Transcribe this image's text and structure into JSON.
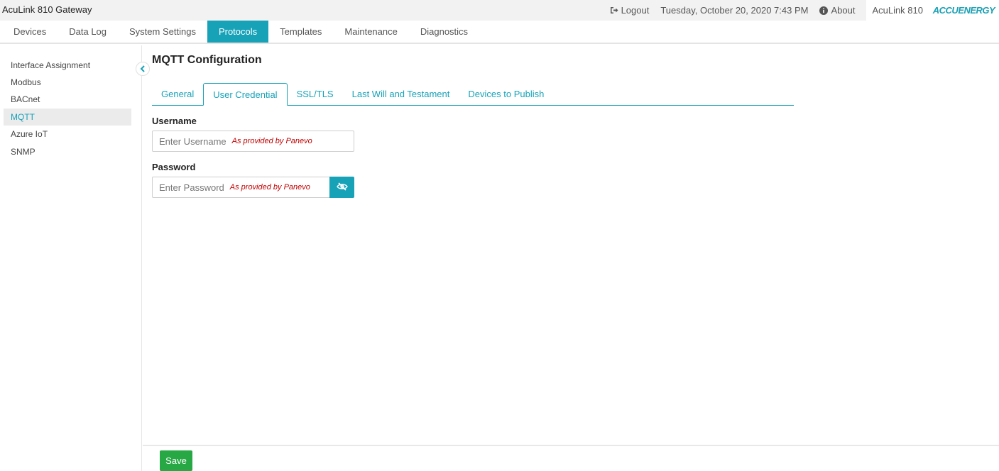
{
  "app": {
    "title": "AcuLink 810 Gateway"
  },
  "header": {
    "logout_label": "Logout",
    "datetime": "Tuesday, October 20, 2020 7:43 PM",
    "about_label": "About",
    "device_name": "AcuLink 810",
    "brand_logo": "ACCUENERGY"
  },
  "nav": {
    "tabs": [
      {
        "label": "Devices"
      },
      {
        "label": "Data Log"
      },
      {
        "label": "System Settings"
      },
      {
        "label": "Protocols",
        "active": true
      },
      {
        "label": "Templates"
      },
      {
        "label": "Maintenance"
      },
      {
        "label": "Diagnostics"
      }
    ]
  },
  "sidebar": {
    "items": [
      {
        "label": "Interface Assignment"
      },
      {
        "label": "Modbus"
      },
      {
        "label": "BACnet"
      },
      {
        "label": "MQTT",
        "active": true
      },
      {
        "label": "Azure IoT"
      },
      {
        "label": "SNMP"
      }
    ],
    "collapse_icon": "chevron-left-icon"
  },
  "main": {
    "title": "MQTT Configuration",
    "tabs": [
      {
        "label": "General"
      },
      {
        "label": "User Credential",
        "active": true
      },
      {
        "label": "SSL/TLS"
      },
      {
        "label": "Last Will and Testament"
      },
      {
        "label": "Devices to Publish"
      }
    ],
    "username": {
      "label": "Username",
      "placeholder": "Enter Username",
      "hint": "As provided by Panevo"
    },
    "password": {
      "label": "Password",
      "placeholder": "Enter Password",
      "hint": "As provided by Panevo",
      "toggle_icon": "eye-slash-icon"
    }
  },
  "footer": {
    "save_label": "Save"
  },
  "colors": {
    "accent": "#17a2b8",
    "save": "#28a745",
    "hint": "#c00000",
    "header_bg": "#f2f2f2"
  }
}
